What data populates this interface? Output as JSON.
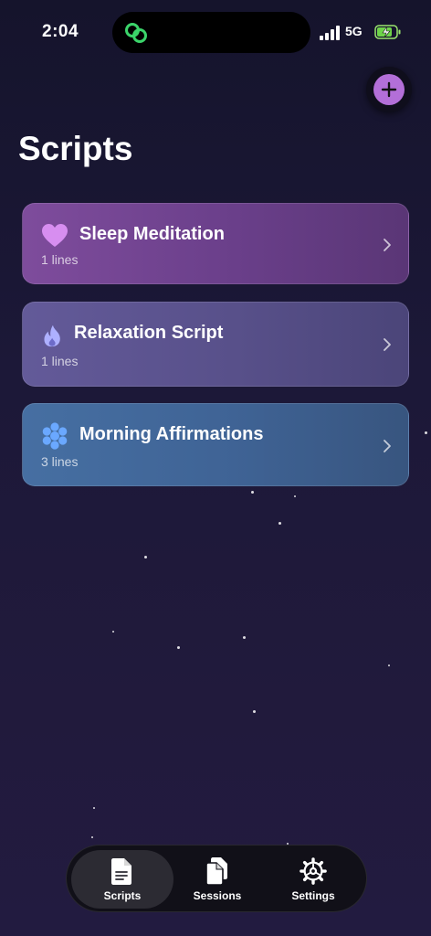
{
  "status_bar": {
    "time": "2:04",
    "network": "5G",
    "island_icon": "link-rings-icon",
    "signal_icon": "cellular-signal-icon",
    "battery_icon": "battery-charging-icon"
  },
  "header": {
    "title": "Scripts",
    "add_button_icon": "plus-icon"
  },
  "scripts": [
    {
      "title": "Sleep Meditation",
      "subtitle": "1 lines",
      "icon": "heart-icon",
      "icon_color": "#d78ef0"
    },
    {
      "title": "Relaxation Script",
      "subtitle": "1 lines",
      "icon": "flame-icon",
      "icon_color": "#aeb0ff"
    },
    {
      "title": "Morning Affirmations",
      "subtitle": "3 lines",
      "icon": "flower-icon",
      "icon_color": "#6aa8ff"
    }
  ],
  "tabs": [
    {
      "label": "Scripts",
      "icon": "document-icon",
      "selected": true
    },
    {
      "label": "Sessions",
      "icon": "documents-stack-icon",
      "selected": false
    },
    {
      "label": "Settings",
      "icon": "gear-icon",
      "selected": false
    }
  ],
  "colors": {
    "accent": "#b36fd8",
    "background": "#1c1838"
  }
}
